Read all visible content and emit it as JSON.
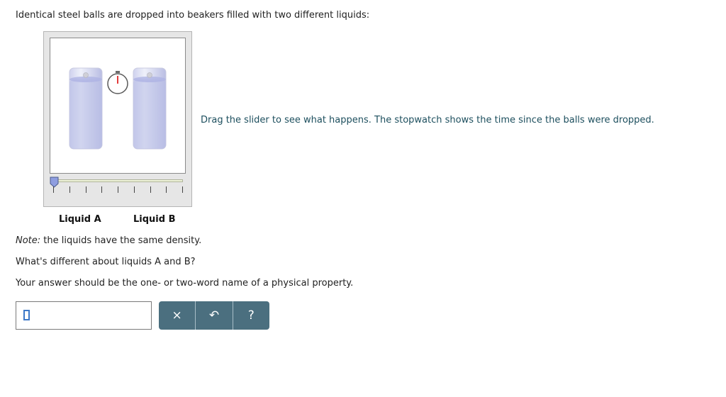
{
  "intro_text": "Identical steel balls are dropped into beakers filled with two different liquids:",
  "simulation": {
    "drag_note": "Drag the slider to see what happens. The stopwatch shows the time since the balls were dropped.",
    "slider_position": 0,
    "tick_count": 9,
    "liquid_a_label": "Liquid A",
    "liquid_b_label": "Liquid B",
    "colors": {
      "liquid": "#b8bde6",
      "glass": "#e4e6ee",
      "stopwatch_hand": "#e33b3b",
      "thumb": "#8f9ee0"
    }
  },
  "note": {
    "prefix": "Note:",
    "text": " the liquids have the same density."
  },
  "question_text": "What's different about liquids A and B?",
  "instruction_text": "Your answer should be the one- or two-word name of a physical property.",
  "answer": {
    "value": ""
  },
  "buttons": {
    "clear": "×",
    "undo": "↶",
    "help": "?"
  },
  "accent_color": "#4b6f7f"
}
